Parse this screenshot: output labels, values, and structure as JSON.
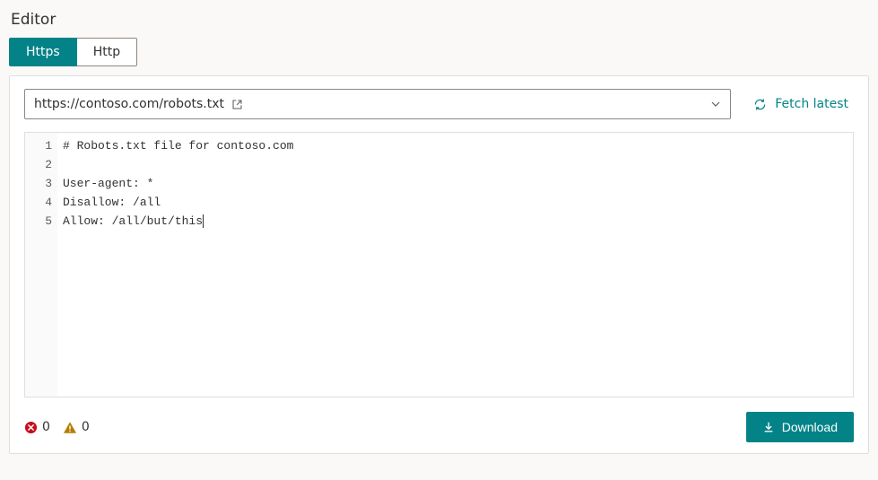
{
  "title": "Editor",
  "tabs": {
    "https": "Https",
    "http": "Http",
    "active": "https"
  },
  "url": {
    "value": "https://contoso.com/robots.txt",
    "open_external_icon": "open-external-icon",
    "dropdown_icon": "chevron-down-icon"
  },
  "fetch": {
    "label": "Fetch latest",
    "icon": "refresh-icon"
  },
  "editor": {
    "lines": [
      "# Robots.txt file for contoso.com",
      "",
      "User-agent: *",
      "Disallow: /all",
      "Allow: /all/but/this"
    ],
    "cursor_line": 5
  },
  "status": {
    "errors": 0,
    "warnings": 0
  },
  "download": {
    "label": "Download",
    "icon": "download-icon"
  },
  "colors": {
    "accent": "#038387",
    "error": "#c50f1f",
    "warning": "#b47d00"
  }
}
